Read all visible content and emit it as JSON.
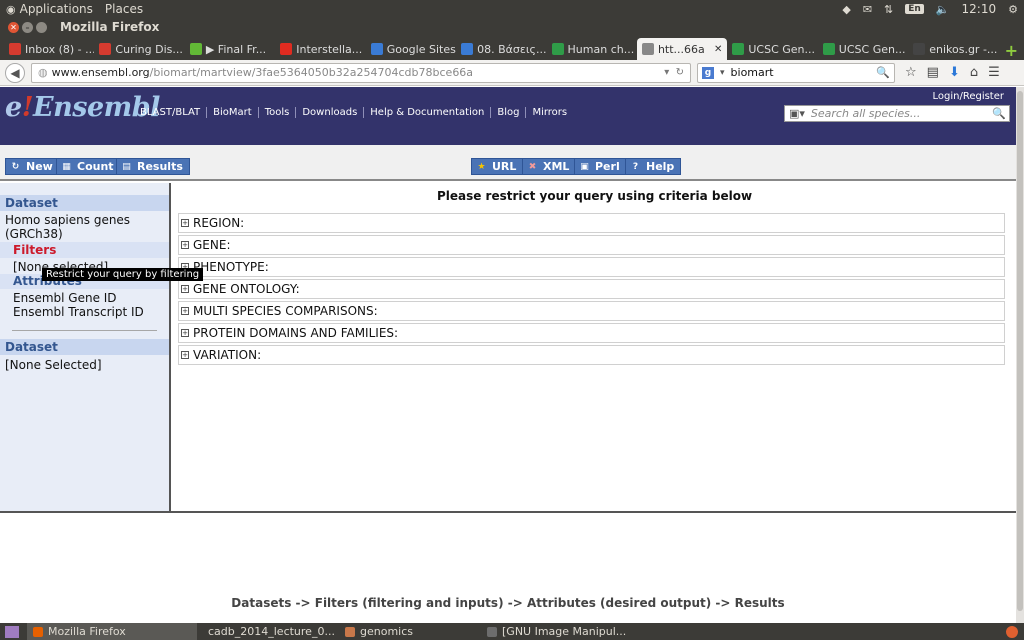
{
  "top_panel": {
    "applications": "Applications",
    "places": "Places",
    "lang": "En",
    "time": "12:10"
  },
  "window": {
    "title": "Mozilla Firefox"
  },
  "tabs": [
    {
      "label": "Inbox (8) - ...",
      "icon": "gmail-icon",
      "color": "#d63b2f"
    },
    {
      "label": "Curing Dis...",
      "icon": "gmail-icon",
      "color": "#d63b2f"
    },
    {
      "label": "▶ Final Fr...",
      "icon": "spotify-icon",
      "color": "#62b936"
    },
    {
      "label": "Interstella...",
      "icon": "youtube-icon",
      "color": "#e02b20"
    },
    {
      "label": "Google Sites",
      "icon": "sites-icon",
      "color": "#3a7bd5"
    },
    {
      "label": "08. Βάσεις...",
      "icon": "sites-icon",
      "color": "#3a7bd5"
    },
    {
      "label": "Human ch...",
      "icon": "ucsc-icon",
      "color": "#2f9c48"
    },
    {
      "label": "htt...66a",
      "icon": "page-icon",
      "color": "#888888",
      "active": true
    },
    {
      "label": "UCSC Gen...",
      "icon": "ucsc-icon",
      "color": "#2f9c48"
    },
    {
      "label": "UCSC Gen...",
      "icon": "ucsc-icon",
      "color": "#2f9c48"
    },
    {
      "label": "enikos.gr -...",
      "icon": "enikos-icon",
      "color": "#444444"
    }
  ],
  "navbar": {
    "url_host": "www.ensembl.org",
    "url_path": "/biomart/martview/3fae5364050b32a254704cdb78bce66a",
    "search_value": "biomart"
  },
  "ensembl": {
    "logo_e": "e",
    "logo_bang": "!",
    "logo_text": "Ensembl",
    "nav": [
      "BLAST/BLAT",
      "BioMart",
      "Tools",
      "Downloads",
      "Help & Documentation",
      "Blog",
      "Mirrors"
    ],
    "login": "Login/Register",
    "species_search_placeholder": "Search all species..."
  },
  "toolbar": {
    "new": "New",
    "count": "Count",
    "results": "Results",
    "url": "URL",
    "xml": "XML",
    "perl": "Perl",
    "help": "Help"
  },
  "sidebar": {
    "dataset_heading": "Dataset",
    "dataset_name": "Homo sapiens genes (GRCh38)",
    "filters_heading": "Filters",
    "filters_value": "[None selected]",
    "attributes_heading": "Attributes",
    "attributes": [
      "Ensembl Gene ID",
      "Ensembl Transcript ID"
    ],
    "dataset2_heading": "Dataset",
    "dataset2_value": "[None Selected]",
    "tooltip": "Restrict your query by filtering"
  },
  "main": {
    "title": "Please restrict your query using criteria below",
    "criteria": [
      "REGION:",
      "GENE:",
      "PHENOTYPE:",
      "GENE ONTOLOGY:",
      "MULTI SPECIES COMPARISONS:",
      "PROTEIN DOMAINS AND FAMILIES:",
      "VARIATION:"
    ]
  },
  "flow_text": "Datasets -> Filters (filtering and inputs) -> Attributes (desired output) -> Results",
  "taskbar": [
    {
      "label": "Mozilla Firefox",
      "active": true
    },
    {
      "label": "cadb_2014_lecture_0...",
      "active": false
    },
    {
      "label": "genomics",
      "active": false
    },
    {
      "label": "[GNU Image Manipul...",
      "active": false
    }
  ]
}
